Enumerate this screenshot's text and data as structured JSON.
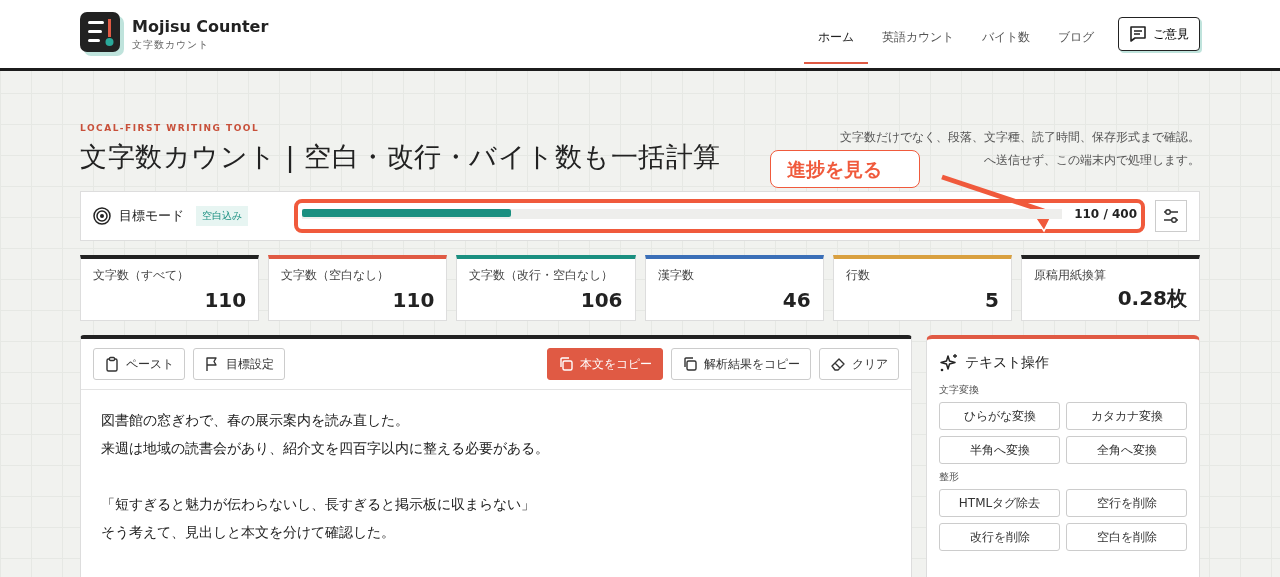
{
  "header": {
    "brand": "Mojisu Counter",
    "tagline": "文字数カウント",
    "nav": [
      {
        "label": "ホーム",
        "selected": true
      },
      {
        "label": "英語カウント",
        "selected": false
      },
      {
        "label": "バイト数",
        "selected": false
      },
      {
        "label": "ブログ",
        "selected": false
      }
    ],
    "feedback_button": "ご意見"
  },
  "hero": {
    "eyebrow": "LOCAL-FIRST WRITING TOOL",
    "title": "文字数カウント | 空白・改行・バイト数も一括計算",
    "description": [
      "文字数だけでなく、段落、文字種、読了時間、保存形式まで確認。",
      "へ送信せず、この端末内で処理します。"
    ]
  },
  "annotation": {
    "label": "進捗を見る"
  },
  "goal": {
    "label": "目標モード",
    "badge": "空白込み",
    "level": 0.275,
    "reading": "110 / 400"
  },
  "stats": [
    {
      "label": "文字数（すべて）",
      "value": "110",
      "color": "#222222"
    },
    {
      "label": "文字数（空白なし）",
      "value": "110",
      "color": "#e05a44"
    },
    {
      "label": "文字数（改行・空白なし）",
      "value": "106",
      "color": "#1a8f80"
    },
    {
      "label": "漢字数",
      "value": "46",
      "color": "#3b6fb8"
    },
    {
      "label": "行数",
      "value": "5",
      "color": "#d9a040"
    },
    {
      "label": "原稿用紙換算",
      "value": "0.28枚",
      "color": "#222222"
    }
  ],
  "editor": {
    "toolbar": [
      {
        "label": "ペースト",
        "kind": "paste",
        "primary": false
      },
      {
        "label": "目標設定",
        "kind": "flag",
        "primary": false
      },
      {
        "label": "本文をコピー",
        "kind": "copy",
        "primary": true
      },
      {
        "label": "解析結果をコピー",
        "kind": "copy",
        "primary": false
      },
      {
        "label": "クリア",
        "kind": "eraser",
        "primary": false
      }
    ],
    "paragraphs": [
      [
        "図書館の窓ぎわで、春の展示案内を読み直した。",
        "来週は地域の読書会があり、紹介文を四百字以内に整える必要がある。"
      ],
      [
        "「短すぎると魅力が伝わらないし、長すぎると掲示板に収まらない」",
        "そう考えて、見出しと本文を分けて確認した。"
      ]
    ]
  },
  "text_tools": {
    "title": "テキスト操作",
    "groups": [
      {
        "heading": "文字変換",
        "buttons": [
          "ひらがな変換",
          "カタカナ変換",
          "半角へ変換",
          "全角へ変換"
        ]
      },
      {
        "heading": "整形",
        "buttons": [
          "HTMLタグ除去",
          "空行を削除",
          "改行を削除",
          "空白を削除"
        ]
      }
    ]
  }
}
